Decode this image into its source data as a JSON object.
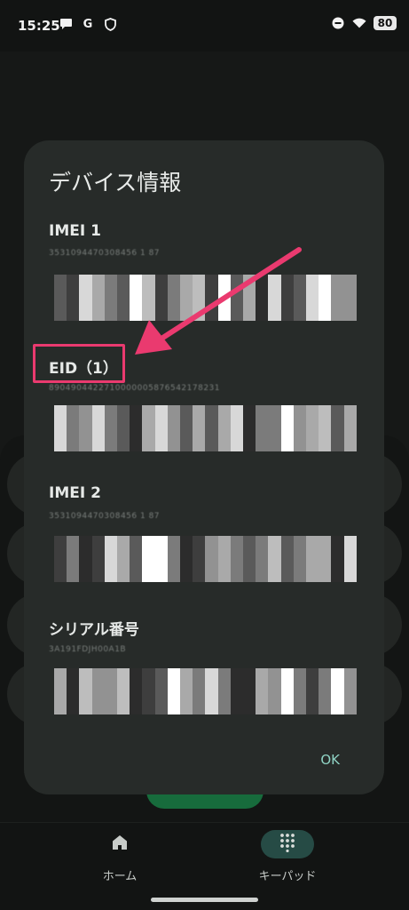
{
  "status_bar": {
    "time": "15:25",
    "left_icons": [
      "chat-bubble-icon",
      "google-icon",
      "shield-icon"
    ],
    "right_icons": [
      "do-not-disturb-icon",
      "wifi-icon"
    ],
    "battery": "80"
  },
  "dialog": {
    "title": "デバイス情報",
    "fields": [
      {
        "label": "IMEI 1",
        "value": "3531094470308456 1 87"
      },
      {
        "label": "EID（1）",
        "value": "8904904422710000005876542178231"
      },
      {
        "label": "IMEI 2",
        "value": "3531094470308456 1 87"
      },
      {
        "label": "シリアル番号",
        "value": "3A191FDJH00A1B"
      }
    ],
    "ok_label": "OK"
  },
  "bottom_nav": {
    "items": [
      {
        "label": "ホーム",
        "icon": "home-icon",
        "active": false
      },
      {
        "label": "キーパッド",
        "icon": "dialpad-icon",
        "active": true
      }
    ]
  },
  "colors": {
    "accent": "#8fd3c4",
    "annotation": "#ea3a6f",
    "dialog_bg": "#272b29",
    "call_button": "#176b3c"
  }
}
